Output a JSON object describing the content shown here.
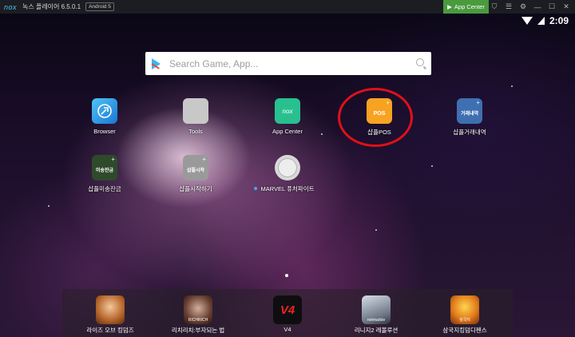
{
  "titlebar": {
    "logo": "nox",
    "title": "녹스 플레이어 6.5.0.1",
    "android_badge": "Android 5",
    "app_center_label": "App Center",
    "icons": [
      "shirt-icon",
      "menu-icon",
      "gear-icon",
      "minimize-icon",
      "maximize-icon",
      "close-icon"
    ],
    "icon_glyphs": [
      "⛉",
      "☰",
      "⚙",
      "—",
      "☐",
      "✕"
    ]
  },
  "status": {
    "time": "2:09"
  },
  "search": {
    "placeholder": "Search Game, App..."
  },
  "apps": [
    {
      "label": "Browser",
      "icon": "browser-icon"
    },
    {
      "label": "Tools",
      "icon": "tools-icon"
    },
    {
      "label": "App Center",
      "icon": "app-center-icon",
      "glyph": "nox"
    },
    {
      "label": "샵플POS",
      "icon": "pos-icon",
      "glyph": "POS"
    },
    {
      "label": "샵플거래내역",
      "icon": "trade-history-icon",
      "glyph": "거래내역"
    },
    {
      "label": "샵플미송잔금",
      "icon": "remit-balance-icon",
      "glyph": "미송잔금"
    },
    {
      "label": "샵플시작하기",
      "icon": "start-icon",
      "glyph": "샵플시작"
    },
    {
      "label": "MARVEL 퓨처파이트",
      "icon": "marvel-icon"
    }
  ],
  "dock": [
    {
      "label": "라이즈 오브 킹덤즈",
      "icon": "rise-of-kingdoms-icon"
    },
    {
      "label": "리치리치:부자되는 법",
      "icon": "richi-richi-icon",
      "glyph": "RICHRICH"
    },
    {
      "label": "V4",
      "icon": "v4-icon",
      "glyph": "V4"
    },
    {
      "label": "리니지2 레볼루션",
      "icon": "lineage2-revolution-icon",
      "glyph": "netmarble"
    },
    {
      "label": "삼국지킹덤디펜스",
      "icon": "samguk-kingdom-defense-icon",
      "glyph": "삼국지"
    }
  ],
  "colors": {
    "app_center_green": "#4a9a3e",
    "highlight": "#e0101a"
  }
}
